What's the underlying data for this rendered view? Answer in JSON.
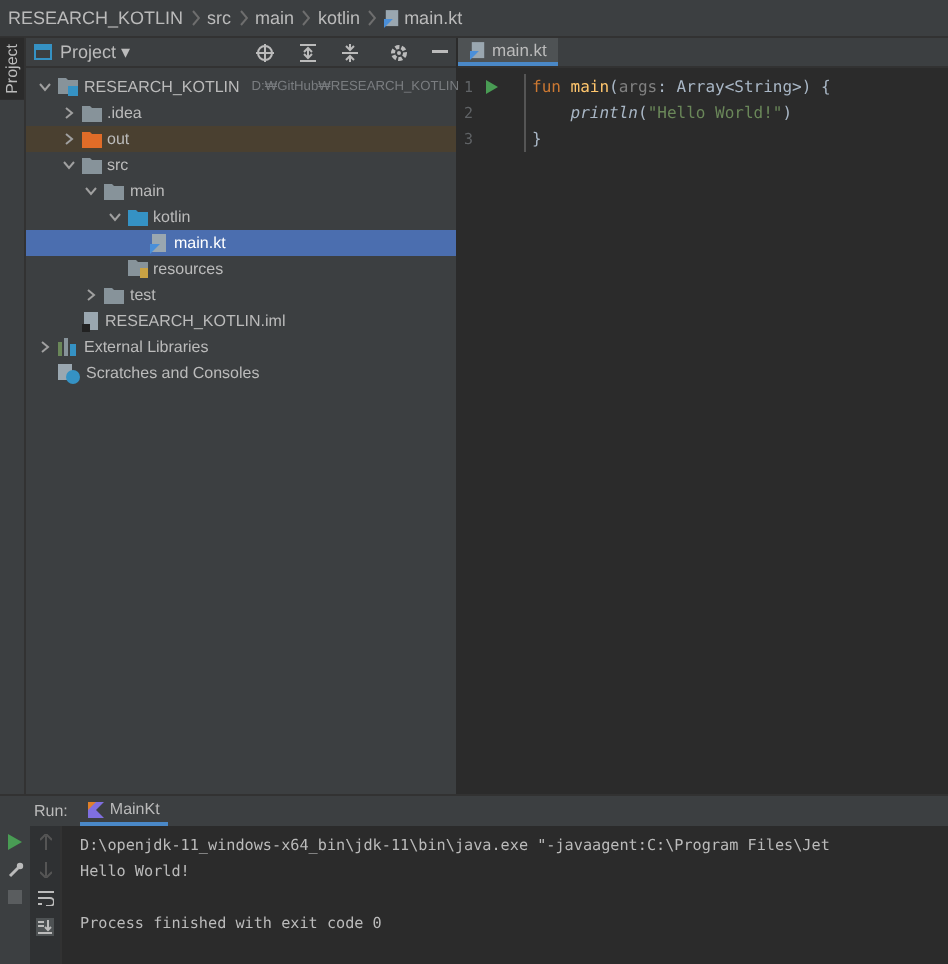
{
  "breadcrumb": [
    "RESEARCH_KOTLIN",
    "src",
    "main",
    "kotlin",
    "main.kt"
  ],
  "side_stripe": {
    "label": "Project",
    "selected": true
  },
  "project_panel": {
    "title": "Project ▾",
    "tree": [
      {
        "kind": "module",
        "label": "RESEARCH_KOTLIN",
        "path": "D:₩GitHub₩RESEARCH_KOTLIN",
        "expanded": true,
        "selected": false,
        "children": [
          {
            "kind": "folder",
            "label": ".idea",
            "expanded": false,
            "selected": false,
            "excluded": false
          },
          {
            "kind": "folder",
            "label": "out",
            "expanded": false,
            "selected": false,
            "excluded": true
          },
          {
            "kind": "folder",
            "label": "src",
            "expanded": true,
            "selected": false,
            "excluded": false,
            "children": [
              {
                "kind": "folder",
                "label": "main",
                "expanded": true,
                "selected": false,
                "excluded": false,
                "children": [
                  {
                    "kind": "source",
                    "label": "kotlin",
                    "expanded": true,
                    "selected": false,
                    "children": [
                      {
                        "kind": "kotlin-file",
                        "label": "main.kt",
                        "selected": true
                      }
                    ]
                  },
                  {
                    "kind": "resources",
                    "label": "resources",
                    "selected": false
                  }
                ]
              },
              {
                "kind": "folder",
                "label": "test",
                "expanded": false,
                "selected": false,
                "excluded": false
              }
            ]
          },
          {
            "kind": "iml",
            "label": "RESEARCH_KOTLIN.iml",
            "selected": false
          }
        ]
      },
      {
        "kind": "libraries",
        "label": "External Libraries",
        "expanded": false,
        "selected": false
      },
      {
        "kind": "scratches",
        "label": "Scratches and Consoles",
        "selected": false
      }
    ]
  },
  "editor": {
    "tabs": [
      {
        "label": "main.kt",
        "selected": true
      }
    ],
    "lines": [
      {
        "number": "1",
        "run": true,
        "tokens": [
          {
            "kind": "keyword",
            "text": "fun "
          },
          {
            "kind": "function",
            "text": "main"
          },
          {
            "kind": "plain",
            "text": "("
          },
          {
            "kind": "param",
            "text": "args"
          },
          {
            "kind": "plain",
            "text": ": Array<String>) {"
          }
        ]
      },
      {
        "number": "2",
        "tokens": [
          {
            "kind": "call",
            "text": "    println"
          },
          {
            "kind": "plain",
            "text": "("
          },
          {
            "kind": "string",
            "text": "\"Hello World!\""
          },
          {
            "kind": "plain",
            "text": ")"
          }
        ]
      },
      {
        "number": "3",
        "tokens": [
          {
            "kind": "plain",
            "text": "}"
          }
        ]
      }
    ]
  },
  "run_panel": {
    "label": "Run:",
    "tabs": [
      {
        "label": "MainKt",
        "selected": true
      }
    ],
    "console": [
      [
        "D:\\openjdk-11_windows-x64_bin\\jdk-11\\bin\\java.exe \"-javaagent:C:\\Program Files\\Jet",
        "Hello World!"
      ],
      [
        "Process finished with exit code 0"
      ]
    ]
  }
}
